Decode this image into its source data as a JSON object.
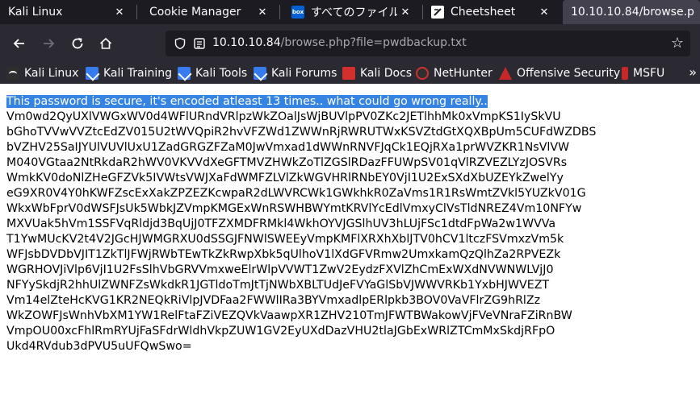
{
  "tabs": [
    {
      "label": "Kali Linux",
      "active": false
    },
    {
      "label": "Cookie Manager",
      "active": false
    },
    {
      "label": "すべてのファイル",
      "active": false
    },
    {
      "label": "Cheetsheet",
      "active": false
    },
    {
      "label": "10.10.10.84/browse.p",
      "active": true
    }
  ],
  "url": {
    "host": "10.10.10.84",
    "path": "/browse.php?file=pwdbackup.txt"
  },
  "bookmarks": [
    {
      "label": "Kali Linux",
      "icon": "kali-dragon-icon"
    },
    {
      "label": "Kali Training",
      "icon": "kali-icon"
    },
    {
      "label": "Kali Tools",
      "icon": "kali-icon"
    },
    {
      "label": "Kali Forums",
      "icon": "kali-icon"
    },
    {
      "label": "Kali Docs",
      "icon": "kali-docs-icon"
    },
    {
      "label": "NetHunter",
      "icon": "nethunter-icon"
    },
    {
      "label": "Offensive Security",
      "icon": "offsec-icon"
    },
    {
      "label": "MSFU",
      "icon": "msfu-icon"
    }
  ],
  "content": {
    "selected_line": "This password is secure, it's encoded atleast 13 times.. what could go wrong really..",
    "lines": [
      "Vm0wd2QyUXlVWGxWV0d4WFlURndVRlpzWkZOalJsWjBUVlpPV0ZKc2JETlhhMk0xVmpKS1IySkVU",
      "bGhoTVVwVVZtcEdZV015U2tWVQpiR2hvVFZWd1ZWWnRjRWRUTWxKSVZtdGtXQXBpUm5CUFdWZDBS",
      "bVZHV25SaIJYUlVUVlUxU1ZadGRGZFZaM0JwVmxad1dWWnRNVFJqCk1EQjRXa1prWVZKR1NsVlVW",
      "M040VGtaa2NtRkdaR2hWV0VKVVdXeGFTMVZHWkZoTlZGSlRDazFFUWpSV01qVlRZVEZLYzJOSVRs",
      "WmkKV0doNlZHeGFZVk5IVWtsVWJXaFdWMFZLVlZkWGVHRlRNbEY0VjI1U2ExSXdXbUZEYkZwelYy",
      "eG9XR0V4Y0hKWFZscExXakZPZEZKcwpaR2dLWVRCWk1GWkhkR0ZaVms1R1RsWmtZVkl5YUZkV01G",
      "WkxWbFprV0dWSFJsUk5WbkJZVmpKMGExWnRSWHBWYmtKRVlYcEdlVmxyClVsTldNREZ4Vm10NFYw",
      "MXVUak5hVm1SSFVqRldjd3BqUjJ0TFZXMDFRMkl4WkhOYVJGSlhUV3hLUjFSc1dtdFpWa2w1WVVa",
      "T1YwMUcKV2t4V2JGcHJWMGRXU0dSSGJFNWlSWEEyVmpKMFlXRXhXblJTV0hCV1ltczFSVmxzVm5k",
      "WFJsbDVDbVJIT1ZkTlJFWjRWbTEwTkZkRwpXbk5qUlhoV1lXdGFVRmw2UmxkamQzQlhZa2RPVEZk",
      "WGRHOVJiVlp6VjI1U2FsSlhVbGRVVmxweElrWlpVVWT1ZwV2EydzFXVlZhCmExWXdNVWNWLVjJ0",
      "NFYySkdjR2hhUlZWNFZsWkdkR1JGTldoTmJtTjNWbXBLTUdJeFVYaGlSbVJWWVRKb1YxbHJWVEZT",
      "Vm14elZteHcKVG1KR2NEQkRiVlpJVDFaa2FWWlIRa3BYVmxadlpERlpkb3BOV0VaVFlrZG9hRlZz",
      "WkZOWFJsWnhVbXM1YW1RelFtaFZiVEZQVkVaawpXR1ZHV210TmJFWTBWakowVjFVeVNraFZiRnBW",
      "VmpOU00xcFhlRmRYUjFaSFdrWldhVkpZUW1GV2EyUXdDazVHU2tlaJGbExWRlZTCmMxSkdjRFpO",
      "Ukd4RVdub3dPVU5uUFQwSwo="
    ]
  }
}
